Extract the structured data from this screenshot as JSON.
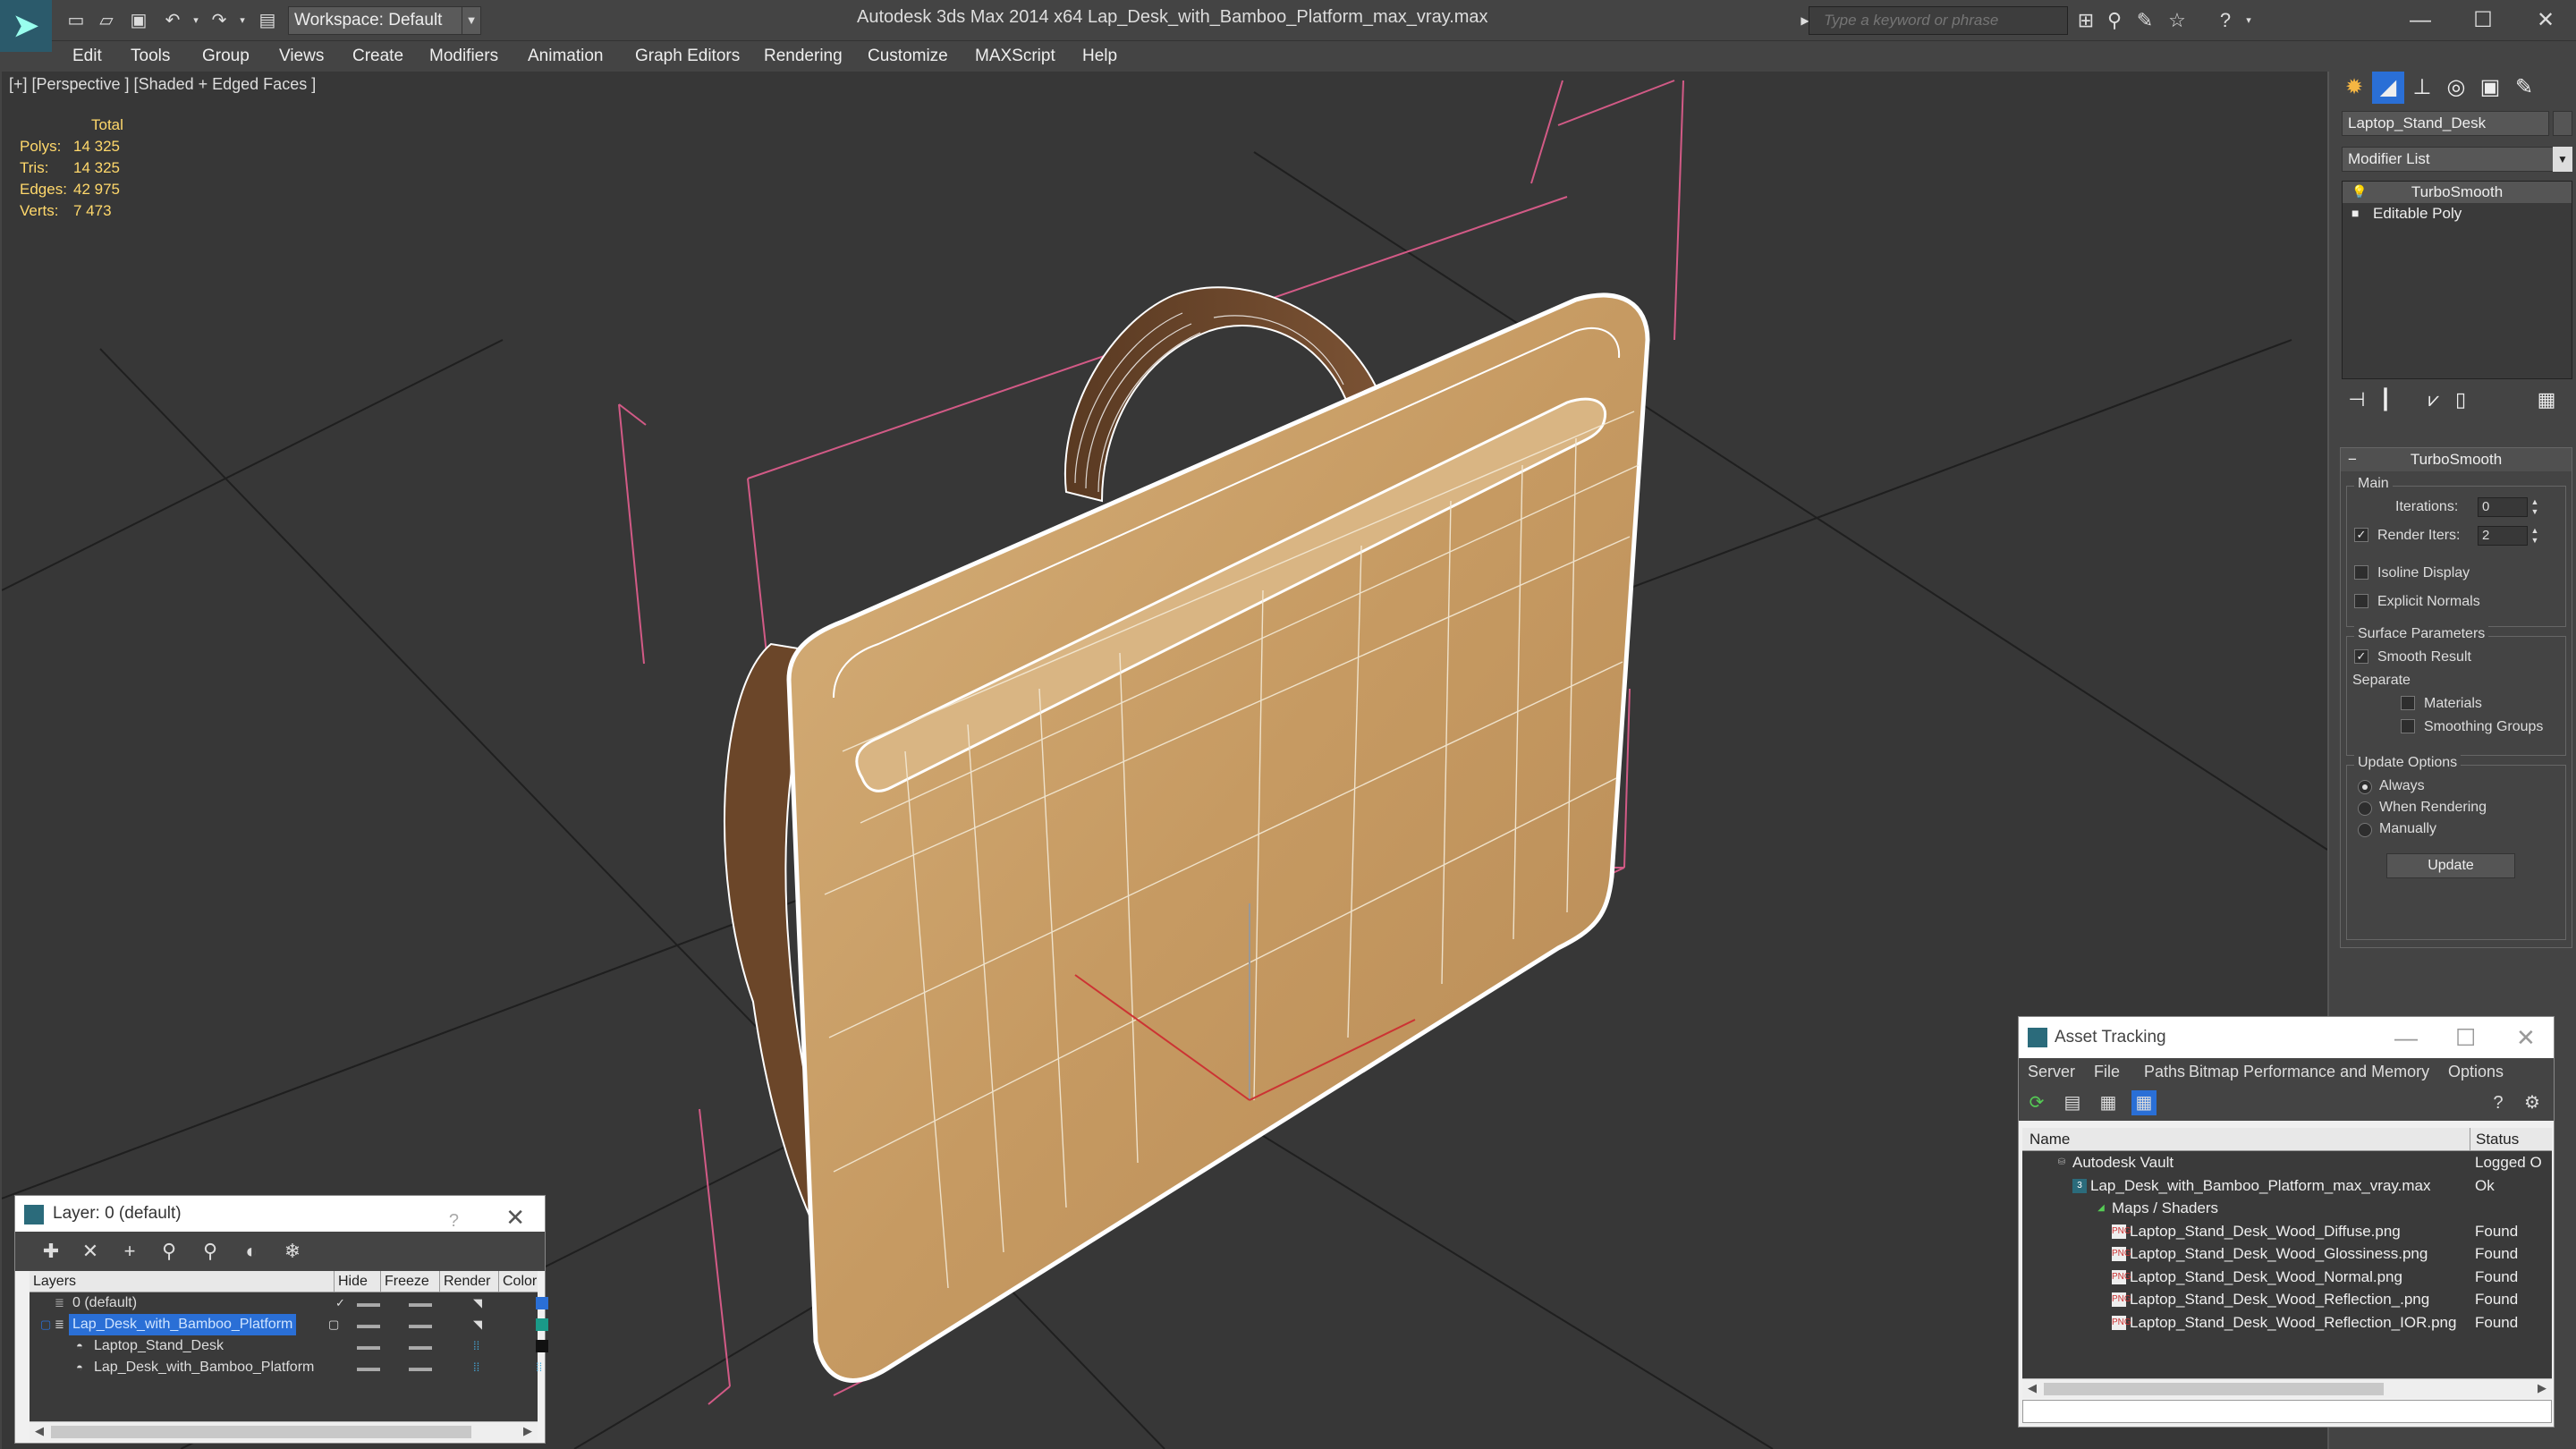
{
  "app": {
    "title": "Autodesk 3ds Max  2014 x64      Lap_Desk_with_Bamboo_Platform_max_vray.max",
    "workspace": "Workspace: Default",
    "search_placeholder": "Type a keyword or phrase"
  },
  "menu": [
    "Edit",
    "Tools",
    "Group",
    "Views",
    "Create",
    "Modifiers",
    "Animation",
    "Graph Editors",
    "Rendering",
    "Customize",
    "MAXScript",
    "Help"
  ],
  "viewport": {
    "label": "[+] [Perspective ] [Shaded + Edged Faces ]",
    "stats": {
      "header": "Total",
      "rows": [
        {
          "label": "Polys:",
          "value": "14 325"
        },
        {
          "label": "Tris:",
          "value": "14 325"
        },
        {
          "label": "Edges:",
          "value": "42 975"
        },
        {
          "label": "Verts:",
          "value": "7 473"
        }
      ]
    }
  },
  "command_panel": {
    "object_name": "Laptop_Stand_Desk",
    "modifier_list": "Modifier List",
    "stack": [
      "TurboSmooth",
      "Editable Poly"
    ],
    "rollout": {
      "title": "TurboSmooth",
      "main_label": "Main",
      "iterations_label": "Iterations:",
      "iterations_value": "0",
      "render_iters_label": "Render Iters:",
      "render_iters_value": "2",
      "isoline_label": "Isoline Display",
      "explicit_normals_label": "Explicit Normals",
      "surface_params_label": "Surface Parameters",
      "smooth_result_label": "Smooth Result",
      "separate_label": "Separate",
      "materials_label": "Materials",
      "smoothing_groups_label": "Smoothing Groups",
      "update_options_label": "Update Options",
      "always_label": "Always",
      "when_rendering_label": "When Rendering",
      "manually_label": "Manually",
      "update_button": "Update"
    }
  },
  "layer_window": {
    "title": "Layer: 0 (default)",
    "help": "?",
    "columns": {
      "layers": "Layers",
      "hide": "Hide",
      "freeze": "Freeze",
      "render": "Render",
      "color": "Color"
    },
    "rows": [
      {
        "name": "0 (default)",
        "indent": 1,
        "selected": false,
        "color": "#2a6fd6"
      },
      {
        "name": "Lap_Desk_with_Bamboo_Platform",
        "indent": 1,
        "selected": true,
        "color": "#1a9a88"
      },
      {
        "name": "Laptop_Stand_Desk",
        "indent": 2,
        "selected": false,
        "color": "#111111"
      },
      {
        "name": "Lap_Desk_with_Bamboo_Platform",
        "indent": 2,
        "selected": false,
        "color": "#1a9a88"
      }
    ]
  },
  "asset_window": {
    "title": "Asset Tracking",
    "menu": [
      "Server",
      "File",
      "Paths",
      "Bitmap Performance and Memory",
      "Options"
    ],
    "columns": {
      "name": "Name",
      "status": "Status"
    },
    "rows": [
      {
        "name": "Autodesk Vault",
        "status": "Logged O",
        "indent": 1,
        "icon": "vault-icon"
      },
      {
        "name": "Lap_Desk_with_Bamboo_Platform_max_vray.max",
        "status": "Ok",
        "indent": 2,
        "icon": "max-file-icon"
      },
      {
        "name": "Maps / Shaders",
        "status": "",
        "indent": 3,
        "icon": "maps-icon"
      },
      {
        "name": "Laptop_Stand_Desk_Wood_Diffuse.png",
        "status": "Found",
        "indent": 4,
        "icon": "png-icon"
      },
      {
        "name": "Laptop_Stand_Desk_Wood_Glossiness.png",
        "status": "Found",
        "indent": 4,
        "icon": "png-icon"
      },
      {
        "name": "Laptop_Stand_Desk_Wood_Normal.png",
        "status": "Found",
        "indent": 4,
        "icon": "png-icon"
      },
      {
        "name": "Laptop_Stand_Desk_Wood_Reflection_.png",
        "status": "Found",
        "indent": 4,
        "icon": "png-icon"
      },
      {
        "name": "Laptop_Stand_Desk_Wood_Reflection_IOR.png",
        "status": "Found",
        "indent": 4,
        "icon": "png-icon"
      }
    ]
  },
  "colors": {
    "viewport_bg": "#373737",
    "wood": "#c9a06a",
    "stats_text": "#ffd86b",
    "selection": "#2a6fd6"
  }
}
